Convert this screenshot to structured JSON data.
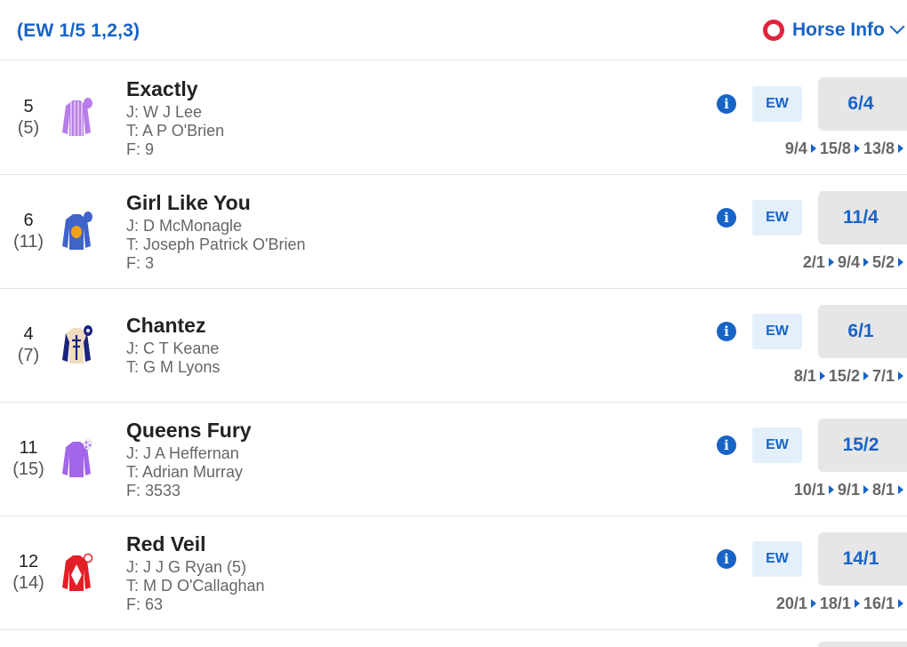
{
  "header": {
    "terms": "(EW 1/5 1,2,3)",
    "horse_info_label": "Horse Info",
    "colors": {
      "accent": "#1763c6",
      "ring": "#e0243c"
    }
  },
  "runners": [
    {
      "number": "5",
      "draw": "(5)",
      "name": "Exactly",
      "jockey": "J: W J Lee",
      "trainer": "T: A P O'Brien",
      "form": "F: 9",
      "silk": "lilac",
      "ew_label": "EW",
      "odds": "6/4",
      "previous_odds": [
        "9/4",
        "15/8",
        "13/8"
      ]
    },
    {
      "number": "6",
      "draw": "(11)",
      "name": "Girl Like You",
      "jockey": "J: D McMonagle",
      "trainer": "T: Joseph Patrick O'Brien",
      "form": "F: 3",
      "silk": "royal-blue-orange-disc",
      "ew_label": "EW",
      "odds": "11/4",
      "previous_odds": [
        "2/1",
        "9/4",
        "5/2"
      ]
    },
    {
      "number": "4",
      "draw": "(7)",
      "name": "Chantez",
      "jockey": "J: C T Keane",
      "trainer": "T: G M Lyons",
      "form": "",
      "silk": "beige-navy-cross",
      "ew_label": "EW",
      "odds": "6/1",
      "previous_odds": [
        "8/1",
        "15/2",
        "7/1"
      ]
    },
    {
      "number": "11",
      "draw": "(15)",
      "name": "Queens Fury",
      "jockey": "J: J A Heffernan",
      "trainer": "T: Adrian Murray",
      "form": "F: 3533",
      "silk": "purple",
      "ew_label": "EW",
      "odds": "15/2",
      "previous_odds": [
        "10/1",
        "9/1",
        "8/1"
      ]
    },
    {
      "number": "12",
      "draw": "(14)",
      "name": "Red Veil",
      "jockey": "J: J J G Ryan (5)",
      "trainer": "T: M D O'Callaghan",
      "form": "F: 63",
      "silk": "red-white-diamond",
      "ew_label": "EW",
      "odds": "14/1",
      "previous_odds": [
        "20/1",
        "18/1",
        "16/1"
      ]
    }
  ]
}
